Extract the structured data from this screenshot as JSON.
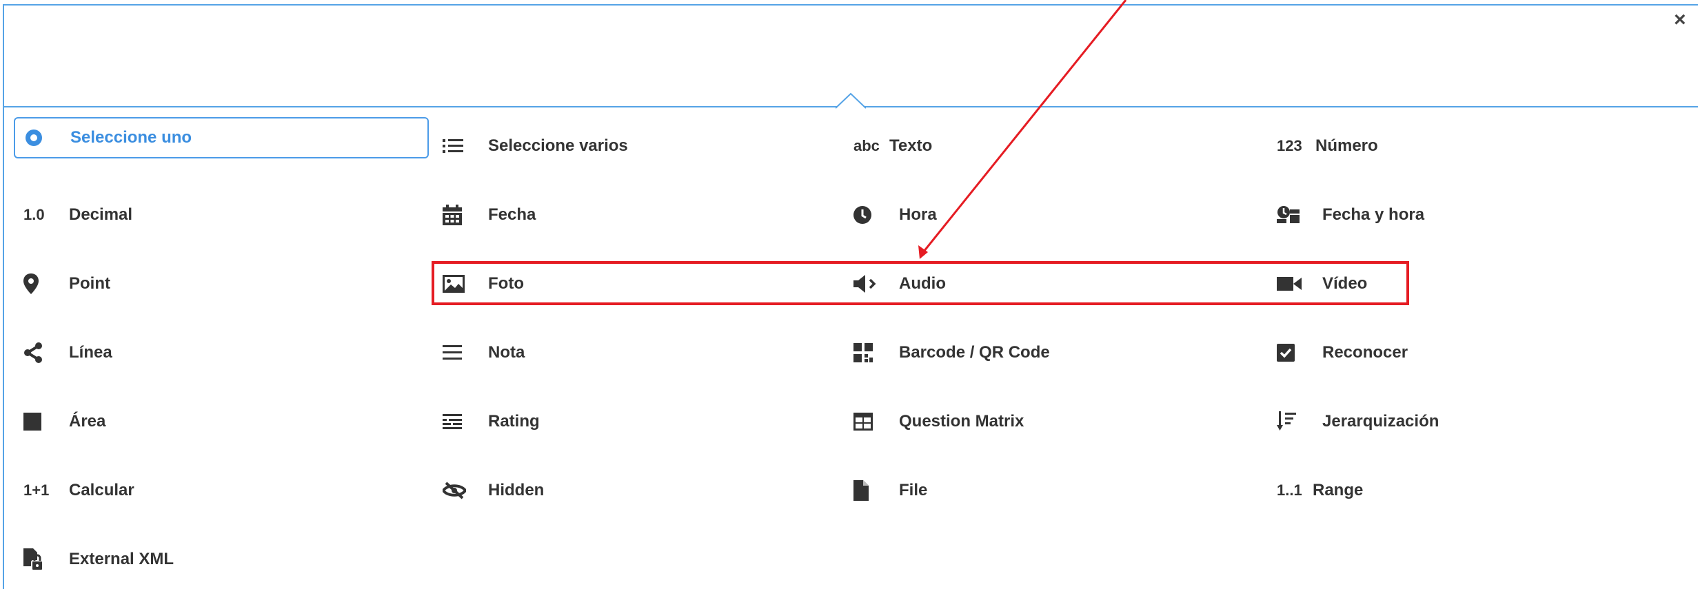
{
  "close_label": "×",
  "colors": {
    "accent": "#4b9be8",
    "highlight": "#e51c23",
    "text": "#333333"
  },
  "items": [
    {
      "label": "Seleccione uno",
      "icon": "radio-icon",
      "selected": true
    },
    {
      "label": "Seleccione varios",
      "icon": "list-icon"
    },
    {
      "label": "Texto",
      "icon": "abc-icon",
      "icon_text": "abc"
    },
    {
      "label": "Número",
      "icon": "number-icon",
      "icon_text": "123"
    },
    {
      "label": "Decimal",
      "icon": "decimal-icon",
      "icon_text": "1.0"
    },
    {
      "label": "Fecha",
      "icon": "calendar-icon"
    },
    {
      "label": "Hora",
      "icon": "clock-icon"
    },
    {
      "label": "Fecha y hora",
      "icon": "datetime-icon"
    },
    {
      "label": "Point",
      "icon": "map-pin-icon"
    },
    {
      "label": "Foto",
      "icon": "photo-icon"
    },
    {
      "label": "Audio",
      "icon": "speaker-icon"
    },
    {
      "label": "Vídeo",
      "icon": "video-camera-icon"
    },
    {
      "label": "Línea",
      "icon": "share-icon"
    },
    {
      "label": "Nota",
      "icon": "menu-lines-icon"
    },
    {
      "label": "Barcode / QR Code",
      "icon": "qr-code-icon"
    },
    {
      "label": "Reconocer",
      "icon": "checkbox-icon"
    },
    {
      "label": "Área",
      "icon": "square-icon"
    },
    {
      "label": "Rating",
      "icon": "rating-icon"
    },
    {
      "label": "Question Matrix",
      "icon": "table-icon"
    },
    {
      "label": "Jerarquización",
      "icon": "sort-icon"
    },
    {
      "label": "Calcular",
      "icon": "calculate-icon",
      "icon_text": "1+1"
    },
    {
      "label": "Hidden",
      "icon": "eye-slash-icon"
    },
    {
      "label": "File",
      "icon": "file-icon"
    },
    {
      "label": "Range",
      "icon": "range-icon",
      "icon_text": "1..1"
    },
    {
      "label": "External XML",
      "icon": "external-xml-icon"
    }
  ]
}
